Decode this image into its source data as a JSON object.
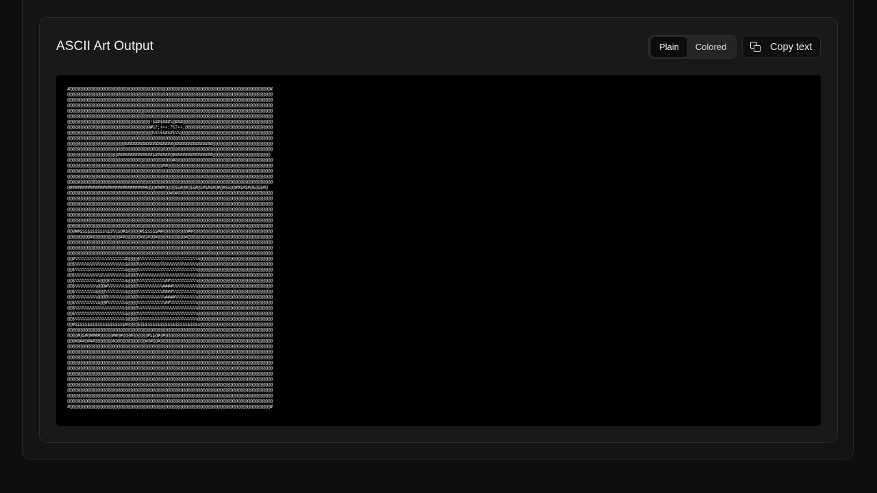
{
  "card": {
    "title": "ASCII Art Output",
    "mode_toggle": {
      "options": [
        "Plain",
        "Colored"
      ],
      "selected": "Plain"
    },
    "copy_button_label": "Copy text",
    "copy_icon": "copy-icon"
  },
  "ascii_art": "#@@@@@@@@@@@@@@@@@@@@@@@@@@@@@@@@@@@@@@@@@@@@@@@@@@@@@@@@@@@@@@@@@@@@@@@@@@@@@@@@#\n@@@@@@@@@@@@@@@@@@@@@@@@@@@@@@@@@@@@@@@@@@@@@@@@@@@@@@@@@@@@@@@@@@@@@@@@@@@@@@@@@@\n@@@@@@@@@@@@@@@@@@@@@@@@@@@@@@@@@@@@@@@@@@@@@@@@@@@@@@@@@@@@@@@@@@@@@@@@@@@@@@@@@@\n@@@@@@@@@@@@@@@@@@@@@@@@@@@@@@@@@@@@@@@@@@@@@@@@@@@@@@@@@@@@@@@@@@@@@@@@@@@@@@@@@@\n@@@@@@@@@@@@@@@@@@@@@@@@@@@@@@@@@@@@@@@@@@@@@@@@@@@@@@@@@@@@@@@@@@@@@@@@@@@@@@@@@@\n@@@@@@@@@@@@@@@@@@@@@@@@@@@@@@@@@@@@@@@@@@@@@@@@@@@@@@@@@@@@@@@@@@@@@@@@@@@@@@@@@@\n@@@@@@@@@@@@@@@@@@@@@@@@@@@@@@@@@!$##$###%@###@@@@@@@@@@@@@@@@@@@@@@@@@@@@@@@@@@@@\n@@@@@@@@@@@@@@@@@@@@@@@@@@@@@@@@@#%?;+++:?%?++;@@@@@@@@@@@@@@@@@@@@@@@@@@@@@@@@@@@\n@@@@@@@@@@@@@@@@@@@@@@@@@@@@@@@@@@%$%$$#$#$%%@@@@@@@@@@@@@@@@@@@@@@@@@@@@@@@@@@@@@\n@@@@@@@@@@@@@@@@@@@@@@@@@@@@@@@@@@@@@@@@@@@@@@@@@@@@@@@@@@@@@@@@@@@@@@@@@@@@@@@@@@\n@@@@@@@@@@@@@@@@@@@@@@@###################@###############@@@@@@@@@@@@@@@@@@@@@@@@\n@@@@@@@@@@@@@@@@@@@@@@@@@@@@@@@@@@@@@@@@@@@@@@@@@@@@@@@@@@@@@@@@@@@@@@@@@@@@@@@@@@\n@@@@@@@@@@@@@@@@@@@@##############$######@################@@@@@@@@@@@@@@@@@@@@@@@\n@@@@@@@@@@@@@@@@@@@@@@@@@@@@@@@@@@@@@@@@@@#@@@@@@@@@@@@@@@@@@@@@@@@@@@@@@@@@@@@@@@\n@@@@@@@@@@@@@@@@@@@@@@@@@@@@@@@@@@@@@@##@@@@@@@@@@@@@@@@@@@@@@@@@@@@@@@@@@@@@@@@@@\n@@@@@@@@@@@@@@@@@@@@@@@@@@@@@@@@@@@@@@@@@@@@@@@@@@@@@@@@@@@@@@@@@@@@@@@@@@@@@@@@@@\n@@@@@@@@@@@@@@@@@@@@@@@@@@@@@@@@@@@@@@@@@@@@@@@@@@@@@@@@@@@@@@@@@@@@@@@@@@@@@@@@@@\n@@@@@@@@@@@@@@@@@@@@@@@@@@@@@@@@@@@@@@@@@@@@@@@@@@@@@@@@@@@@@@@@@@@@@@@@@@@@@@@@@@\n@###############################@@@####@@@@$$#@#@$$#@$#$#$#@#@#$$@@##$#$#@$@$$#@\n@@@@@@@@@@@@@@@@@@@@@@@@@@@@@@@@@@@@@@@@@#@#@@@@@@@@@@@@@@@@@@@@@@@@@@@@@@@@@@@@@@\n@@@@@@@@@@@@@@@@@@@@@@@@@@@@@@@@@@@@@@@@@@@@@@@@@@@@@@@@@@@@@@@@@@@@@@@@@@@@@@@@@@\n@@@@@@@@@@@@@@@@@@@@@@@@@@@@@@@@@@@@@@@@@@@@@@@@@@@@@@@@@@@@@@@@@@@@@@@@@@@@@@@@@@\n@@@@@@@@@@@@@@@@@@@@@@@@@@@@@@@@@@@@@@@@@@@@@@@@@@@@@@@@@@@@@@@@@@@@@@@@@@@@@@@@@@\n@@@@@@@@@@@@@@@@@@@@@@@@@@@@@@@@@@@@@@@@@@@@@@@@@@@@@@@@@@@@@@@@@@@@@@@@@@@@@@@@@@\n@@@@@@@@@@@@@@@@@@@@@@@@@@@@@@@@@@@@@@@@@@@@@@@@@@@@@@@@@@@@@@@@@@@@@@@@@@@@@@@@@@\n@@@@@@@@@@@@@@@@@@@@@@@@@@@@@@@@@@@@@@@@@@@@@@@@@@@@@@@@@@@@@@@@@@@@@@@@@@@@@@@@@@\n@@@##$$$$$$$$$$%$$%%$@#$@@@@@#$$$$$$##@@@@@@@@@@##@@@@@@@@@@@@@@@@@@@@@@@@@@@@@@@@\n@@@@@@@@@#@@@@@@@@@@@##@@@@@@#@@#@@#@@@@@@@@@@@#@@@@@@@@@@@@@@@@@@@@@@@@@@@@@@@@@@\n@@@@@@@@@@@@@@@@@@@@@@@@@@@@@@@@@@@@@@@@@@@@@@@@@@@@@@@@@@@@@@@@@@@@@@@@@@@@@@@@@@\n@@@@@@@@@@@@@@@@@@@@@@@@@@@@@@@@@@@@@@@@@@@@@@@@@@@@@@@@@@@@@@@@@@@@@@@@@@@@@@@@@@\n@@@@@@@@@@@@@@@@@@@@@@@@@@@@@@@@@@@@@@@@@@@@@@@@@@@@@@@@@@@@@@@@@@@@@@@@@@@@@@@@@@\n@@#%%%%%%%%%%%%%%%%%%%%#@@@@$%%%%%%%%%%%%%%%%%%%%%%%$@@@@@@@@@@@@@@@@@@@@@@@@@@@@@\n@@$%%%%%%%%%%%%%%%%%%%%$@@@@%%%%%%%%%%%%%%%%%%%%%%%%@@@@@@@@@@@@@@@@@@@@@@@@@@@@@@\n@@$%%%%%%%%%%%%%%%%%%%%$@@@@%%%%%%%%%%%%%%%%%%%%%%%%@@@@@@@@@@@@@@@@@@@@@@@@@@@@@@\n@@$%%%%%%%%%%$%%%%%%%%%$@@@@%%%%%%%%%%%%%%%%%%%%%%%%@@@@@@@@@@@@@@@@@@@@@@@@@@@@@@\n@@$%%%%%%%%%$@@@$%%%%%%$@@@@%%%%%%%%%%%##%%%%%%%%%%%@@@@@@@@@@@@@@@@@@@@@@@@@@@@@@\n@@$%%%%%%%%%@@@#%%%%%%%$@@@@%%%%%%%%%%####%%%%%%%%%%@@@@@@@@@@@@@@@@@@@@@@@@@@@@@@\n@@$%%%%%%%%$@@@%%%%%%%%$@@@@%%%%%%%%%%####%%%%%%%%%%@@@@@@@@@@@@@@@@@@@@@@@@@@@@@@\n@@$%%%%%%%%%@@@@%%%%%%%$@@@@%%%%%%%%%%%####%%%%%%%%%@@@@@@@@@@@@@@@@@@@@@@@@@@@@@@\n@@$%%%%%%%%%$@@#%%%%%%%$@@@@%%%%%%%%%%%##%%%%%%%%%%%@@@@@@@@@@@@@@@@@@@@@@@@@@@@@@\n@@$%%%%%%%%%%%%%%%%%%%%$@@@@%%%%%%%%%%%%%%%%%%%%%%%%@@@@@@@@@@@@@@@@@@@@@@@@@@@@@@\n@@$%%%%%%%%%%%%%%%%%%%%$@@@@%%%%%%%%%%%%%%%%%%%%%%%%@@@@@@@@@@@@@@@@@@@@@@@@@@@@@@\n@@$%%%%%%%%%%%%%%%%%%%%$@@@@%%%%%%%%%%%%%%%%%%%%%%%%@@@@@@@@@@@@@@@@@@@@@@@@@@@@@@\n@@#$$$$$$$$$$$$$$$$$$$$#@@@@$$$$$$$$$$$$$$$$$$$$$$$$$@@@@@@@@@@@@@@@@@@@@@@@@@@@@@\n@@@@@@@@@@@@@@@@@@@@@@@@@@@@@@@@@@@@@@@@@@@@@@@@@@@@@@@@@@@@@@@@@@@@@@@@@@@@@@@@@@\n@@@@#@$#@####@@@@@##@#@@@#@@@@@@#$$@#@#@@@@@@@@@@@@@@@@@@@@@@@@@@@@@@@@@@@@@@@@@@@\n@@@#@##@###@@@@@@@#@@@@@@@@@@@@#@#@@#@@@@@@@@@@@@@@@@@@@@@@@@@@@@@@@@@@@@@@@@@@@@@\n@@@@@@@@@@@@@@@@@@@@@@@@@@@@@@@@@@@@@@@@@@@@@@@@@@@@@@@@@@@@@@@@@@@@@@@@@@@@@@@@@@\n@@@@@@@@@@@@@@@@@@@@@@@@@@@@@@@@@@@@@@@@@@@@@@@@@@@@@@@@@@@@@@@@@@@@@@@@@@@@@@@@@@\n@@@@@@@@@@@@@@@@@@@@@@@@@@@@@@@@@@@@@@@@@@@@@@@@@@@@@@@@@@@@@@@@@@@@@@@@@@@@@@@@@@\n@@@@@@@@@@@@@@@@@@@@@@@@@@@@@@@@@@@@@@@@@@@@@@@@@@@@@@@@@@@@@@@@@@@@@@@@@@@@@@@@@@\n@@@@@@@@@@@@@@@@@@@@@@@@@@@@@@@@@@@@@@@@@@@@@@@@@@@@@@@@@@@@@@@@@@@@@@@@@@@@@@@@@@\n@@@@@@@@@@@@@@@@@@@@@@@@@@@@@@@@@@@@@@@@@@@@@@@@@@@@@@@@@@@@@@@@@@@@@@@@@@@@@@@@@@\n@@@@@@@@@@@@@@@@@@@@@@@@@@@@@@@@@@@@@@@@@@@@@@@@@@@@@@@@@@@@@@@@@@@@@@@@@@@@@@@@@@\n@@@@@@@@@@@@@@@@@@@@@@@@@@@@@@@@@@@@@@@@@@@@@@@@@@@@@@@@@@@@@@@@@@@@@@@@@@@@@@@@@@\n@@@@@@@@@@@@@@@@@@@@@@@@@@@@@@@@@@@@@@@@@@@@@@@@@@@@@@@@@@@@@@@@@@@@@@@@@@@@@@@@@@\n@@@@@@@@@@@@@@@@@@@@@@@@@@@@@@@@@@@@@@@@@@@@@@@@@@@@@@@@@@@@@@@@@@@@@@@@@@@@@@@@@@\n@@@@@@@@@@@@@@@@@@@@@@@@@@@@@@@@@@@@@@@@@@@@@@@@@@@@@@@@@@@@@@@@@@@@@@@@@@@@@@@@@@\n#@@@@@@@@@@@@@@@@@@@@@@@@@@@@@@@@@@@@@@@@@@@@@@@@@@@@@@@@@@@@@@@@@@@@@@@@@@@@@@@@#"
}
